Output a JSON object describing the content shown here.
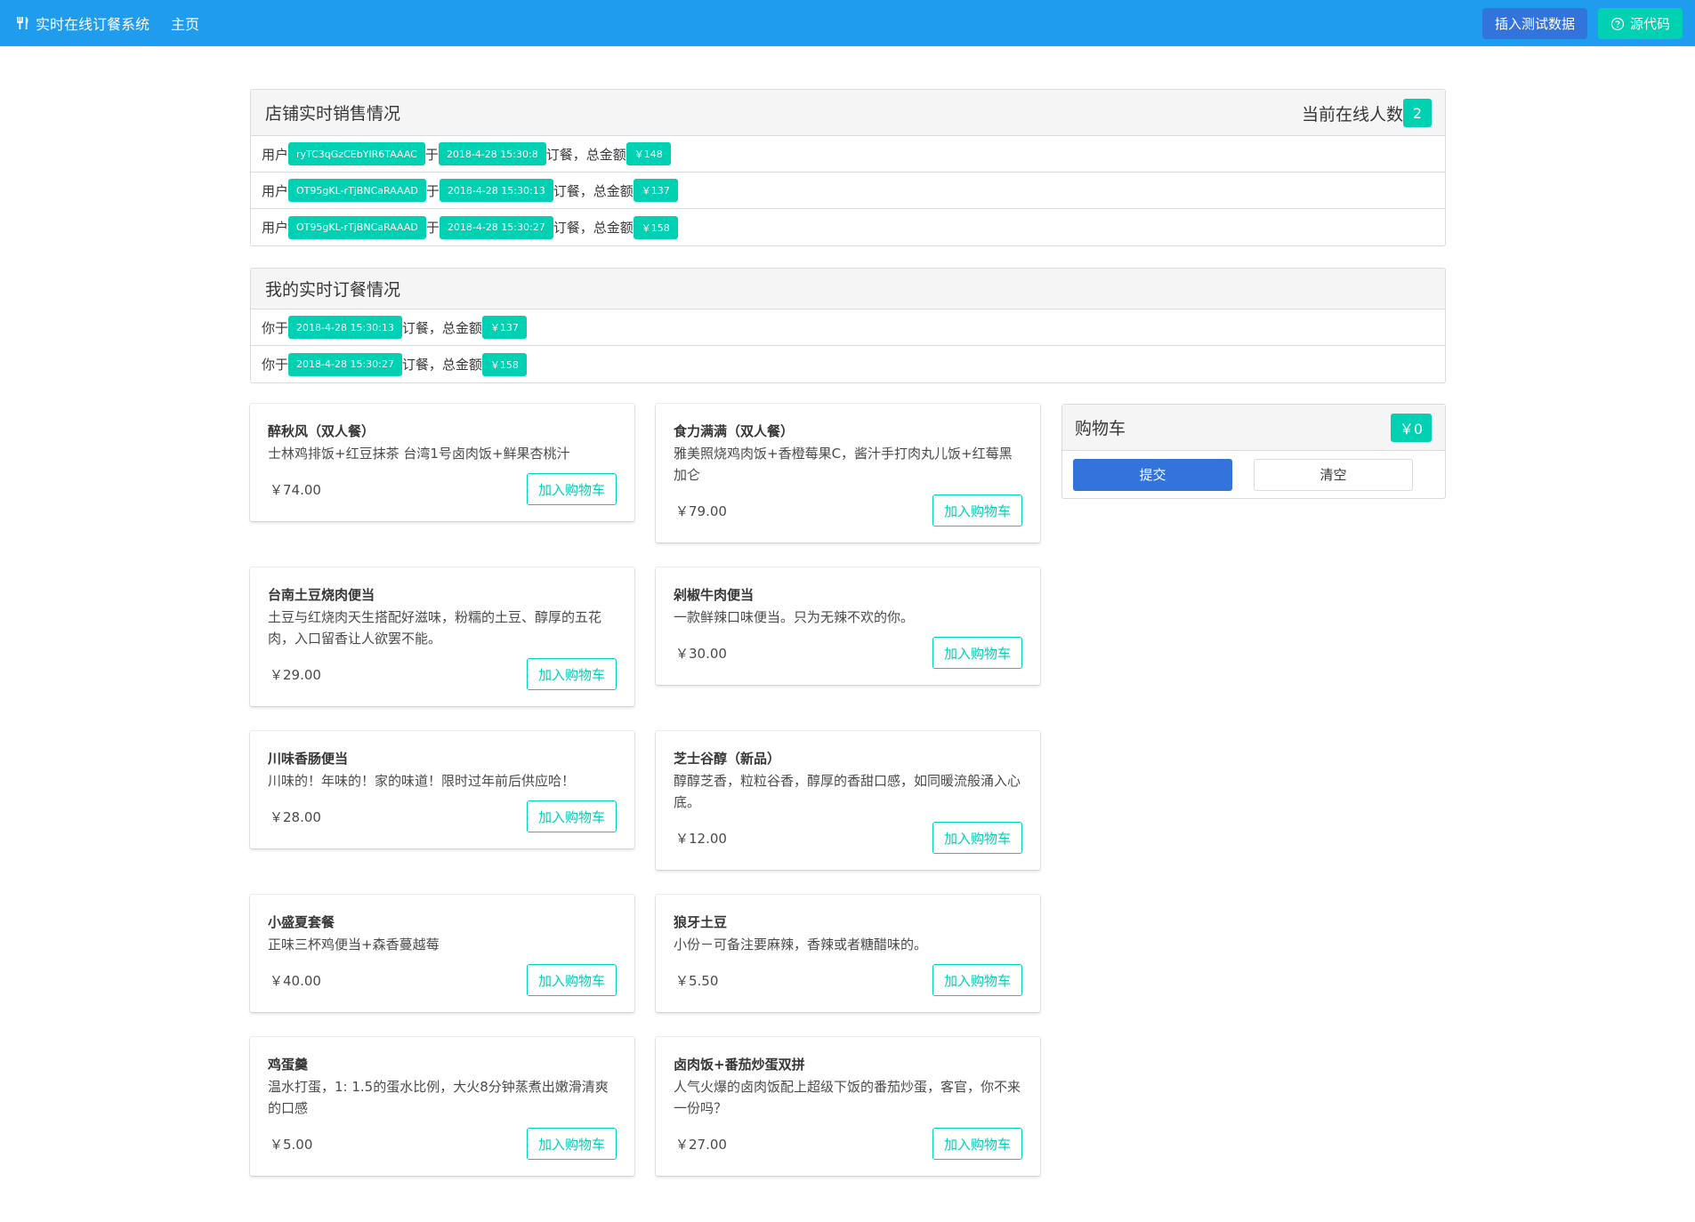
{
  "navbar": {
    "brand": "实时在线订餐系统",
    "home": "主页",
    "insert_test_data": "插入测试数据",
    "source_code": "源代码"
  },
  "store_sales": {
    "title": "店铺实时销售情况",
    "online_label": "当前在线人数",
    "online_count": "2",
    "rows": [
      {
        "prefix": "用户",
        "user": "ryTC3qGzCEbYIR6TAAAC",
        "at": "于",
        "time": "2018-4-28 15:30:8",
        "mid": "订餐，总金额",
        "amount": "￥148"
      },
      {
        "prefix": "用户",
        "user": "OT95gKL-rTjBNCaRAAAD",
        "at": "于",
        "time": "2018-4-28 15:30:13",
        "mid": "订餐，总金额",
        "amount": "￥137"
      },
      {
        "prefix": "用户",
        "user": "OT95gKL-rTjBNCaRAAAD",
        "at": "于",
        "time": "2018-4-28 15:30:27",
        "mid": "订餐，总金额",
        "amount": "￥158"
      }
    ]
  },
  "my_orders": {
    "title": "我的实时订餐情况",
    "rows": [
      {
        "prefix": "你于",
        "time": "2018-4-28 15:30:13",
        "mid": "订餐，总金额",
        "amount": "￥137"
      },
      {
        "prefix": "你于",
        "time": "2018-4-28 15:30:27",
        "mid": "订餐，总金额",
        "amount": "￥158"
      }
    ]
  },
  "menu": {
    "add_label": "加入购物车",
    "items": [
      {
        "name": "醉秋风（双人餐）",
        "desc": "士林鸡排饭+红豆抹茶 台湾1号卤肉饭+鲜果杏桃汁",
        "price": "￥74.00"
      },
      {
        "name": "食力满满（双人餐）",
        "desc": "雅美照烧鸡肉饭+香橙莓果C，酱汁手打肉丸儿饭+红莓黑加仑",
        "price": "￥79.00"
      },
      {
        "name": "台南土豆烧肉便当",
        "desc": "土豆与红烧肉天生搭配好滋味，粉糯的土豆、醇厚的五花肉，入口留香让人欲罢不能。",
        "price": "￥29.00"
      },
      {
        "name": "剁椒牛肉便当",
        "desc": "一款鲜辣口味便当。只为无辣不欢的你。",
        "price": "￥30.00"
      },
      {
        "name": "川味香肠便当",
        "desc": "川味的！年味的！家的味道！限时过年前后供应哈！",
        "price": "￥28.00"
      },
      {
        "name": "芝士谷醇（新品）",
        "desc": "醇醇芝香，粒粒谷香，醇厚的香甜口感，如同暖流般涌入心底。",
        "price": "￥12.00"
      },
      {
        "name": "小盛夏套餐",
        "desc": "正味三杯鸡便当+森香蔓越莓",
        "price": "￥40.00"
      },
      {
        "name": "狼牙土豆",
        "desc": "小份－可备注要麻辣，香辣或者糖醋味的。",
        "price": "￥5.50"
      },
      {
        "name": "鸡蛋羹",
        "desc": "温水打蛋，1: 1.5的蛋水比例，大火8分钟蒸煮出嫩滑清爽的口感",
        "price": "￥5.00"
      },
      {
        "name": "卤肉饭+番茄炒蛋双拼",
        "desc": "人气火爆的卤肉饭配上超级下饭的番茄炒蛋，客官，你不来一份吗？",
        "price": "￥27.00"
      }
    ]
  },
  "cart": {
    "title": "购物车",
    "total": "￥0",
    "submit": "提交",
    "clear": "清空"
  },
  "colors": {
    "navbar": "#209cee",
    "primary": "#3273dc",
    "success": "#00d1b2"
  }
}
